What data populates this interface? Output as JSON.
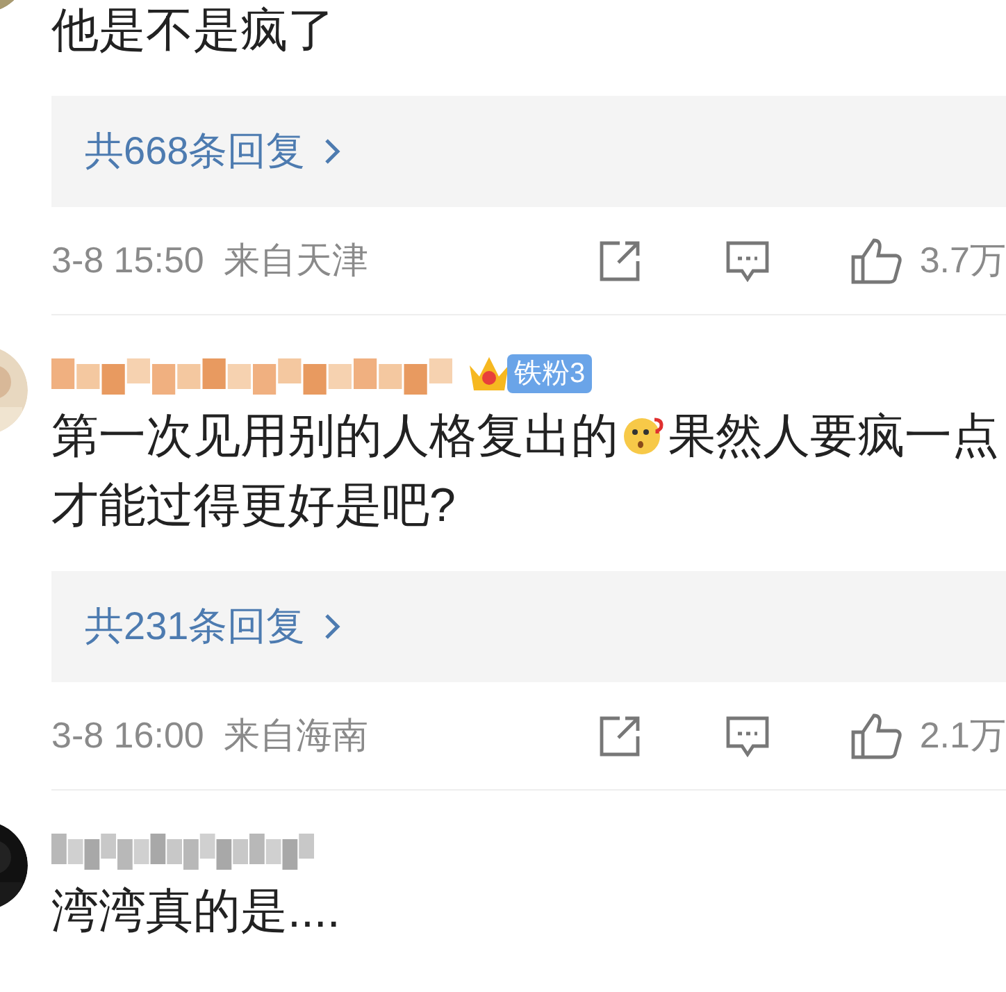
{
  "comments": [
    {
      "kind": "cut",
      "content": [
        {
          "kind": "text",
          "text": "他是不是疯了"
        }
      ],
      "replies": "共668条回复",
      "time": "3-8 15:50",
      "location": "来自天津",
      "likes": "3.7万"
    },
    {
      "kind": "full",
      "badge": {
        "label": "铁粉3"
      },
      "content": [
        {
          "kind": "text",
          "text": "第一次见用别的人格复出的"
        },
        {
          "kind": "emoji"
        },
        {
          "kind": "text",
          "text": "果然人要疯一点才能过得更好是吧?"
        }
      ],
      "replies": "共231条回复",
      "time": "3-8 16:00",
      "location": "来自海南",
      "likes": "2.1万"
    },
    {
      "kind": "full",
      "content": [
        {
          "kind": "text",
          "text": "湾湾真的是...."
        }
      ]
    }
  ]
}
